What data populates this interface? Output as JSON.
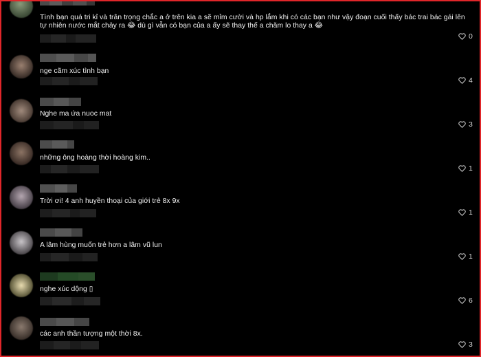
{
  "comments": [
    {
      "text_lines": [
        "Tình bạn quá tri kỉ và trân trọng chắc a ở trên kia a sẽ mỉm cười và hp lắm khi có các bạn như vậy đoạn cuối thấy bác trai bác gái lên",
        "tự nhiên nước mắt chảy ra 😂 dù gì vẫn có bạn của a ấy sẽ thay thế a chăm lo thay a 😂"
      ],
      "likes": "0",
      "like_icon": "heart-outline-icon"
    },
    {
      "text_lines": [
        "nge cãm xúc tình bạn"
      ],
      "likes": "4",
      "like_icon": "heart-outline-icon"
    },
    {
      "text_lines": [
        "Nghe ma ứa nuoc mat"
      ],
      "likes": "3",
      "like_icon": "heart-outline-icon"
    },
    {
      "text_lines": [
        "những ông hoàng thời hoàng kim.."
      ],
      "likes": "1",
      "like_icon": "heart-outline-icon"
    },
    {
      "text_lines": [
        "Trời ơi! 4 anh huyền thoại của giới trẻ 8x 9x"
      ],
      "likes": "1",
      "like_icon": "heart-outline-icon"
    },
    {
      "text_lines": [
        "A lâm hùng muốn trẻ hơn a lâm vũ lun"
      ],
      "likes": "1",
      "like_icon": "heart-outline-icon"
    },
    {
      "text_lines": [
        "nghe xúc dộng ▯"
      ],
      "likes": "6",
      "like_icon": "heart-outline-icon"
    },
    {
      "text_lines": [
        "các anh thần tượng một thời 8x."
      ],
      "likes": "3",
      "like_icon": "heart-outline-icon"
    }
  ],
  "colors": {
    "frame_border": "#e0262a",
    "background": "#000000",
    "text": "#f1f1f1"
  }
}
